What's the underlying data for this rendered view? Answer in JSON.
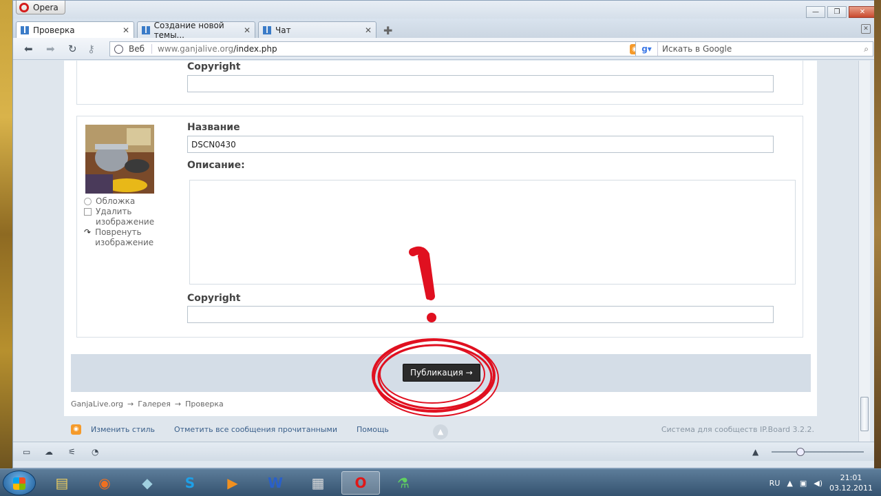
{
  "browser": {
    "menu_label": "Opera",
    "tabs": [
      {
        "label": "Проверка"
      },
      {
        "label": "Создание новой темы..."
      },
      {
        "label": "Чат"
      }
    ],
    "address": {
      "mode_label": "Веб",
      "host": "www.ganjalive.org",
      "path": "/index.php"
    },
    "search": {
      "placeholder": "Искать в Google",
      "engine_icon": "google-icon"
    }
  },
  "page": {
    "first_block": {
      "copyright_label": "Copyright",
      "copyright_value": ""
    },
    "image_block": {
      "title_label": "Название",
      "title_value": "DSCN0430",
      "description_label": "Описание:",
      "copyright_label": "Copyright",
      "copyright_value": "",
      "options": {
        "cover": "Обложка",
        "delete": "Удалить изображение",
        "rotate": "Повренуть изображение"
      }
    },
    "publish_button": "Публикация →",
    "breadcrumb": [
      "GanjaLive.org",
      "Галерея",
      "Проверка"
    ],
    "breadcrumb_sep": "→",
    "footer": {
      "change_style": "Изменить стиль",
      "mark_read": "Отметить все сообщения прочитанными",
      "help": "Помощь",
      "powered_by": "Система для сообществ IP.Board 3.2.2."
    }
  },
  "annotation": {
    "mark": "!",
    "color": "#e01020"
  },
  "taskbar": {
    "language": "RU",
    "time": "21:01",
    "date": "03.12.2011",
    "apps": [
      "explorer-icon",
      "firefox-icon",
      "notepad-icon",
      "skype-icon",
      "media-player-icon",
      "word-icon",
      "media-player-classic-icon",
      "opera-icon",
      "app-icon"
    ]
  }
}
